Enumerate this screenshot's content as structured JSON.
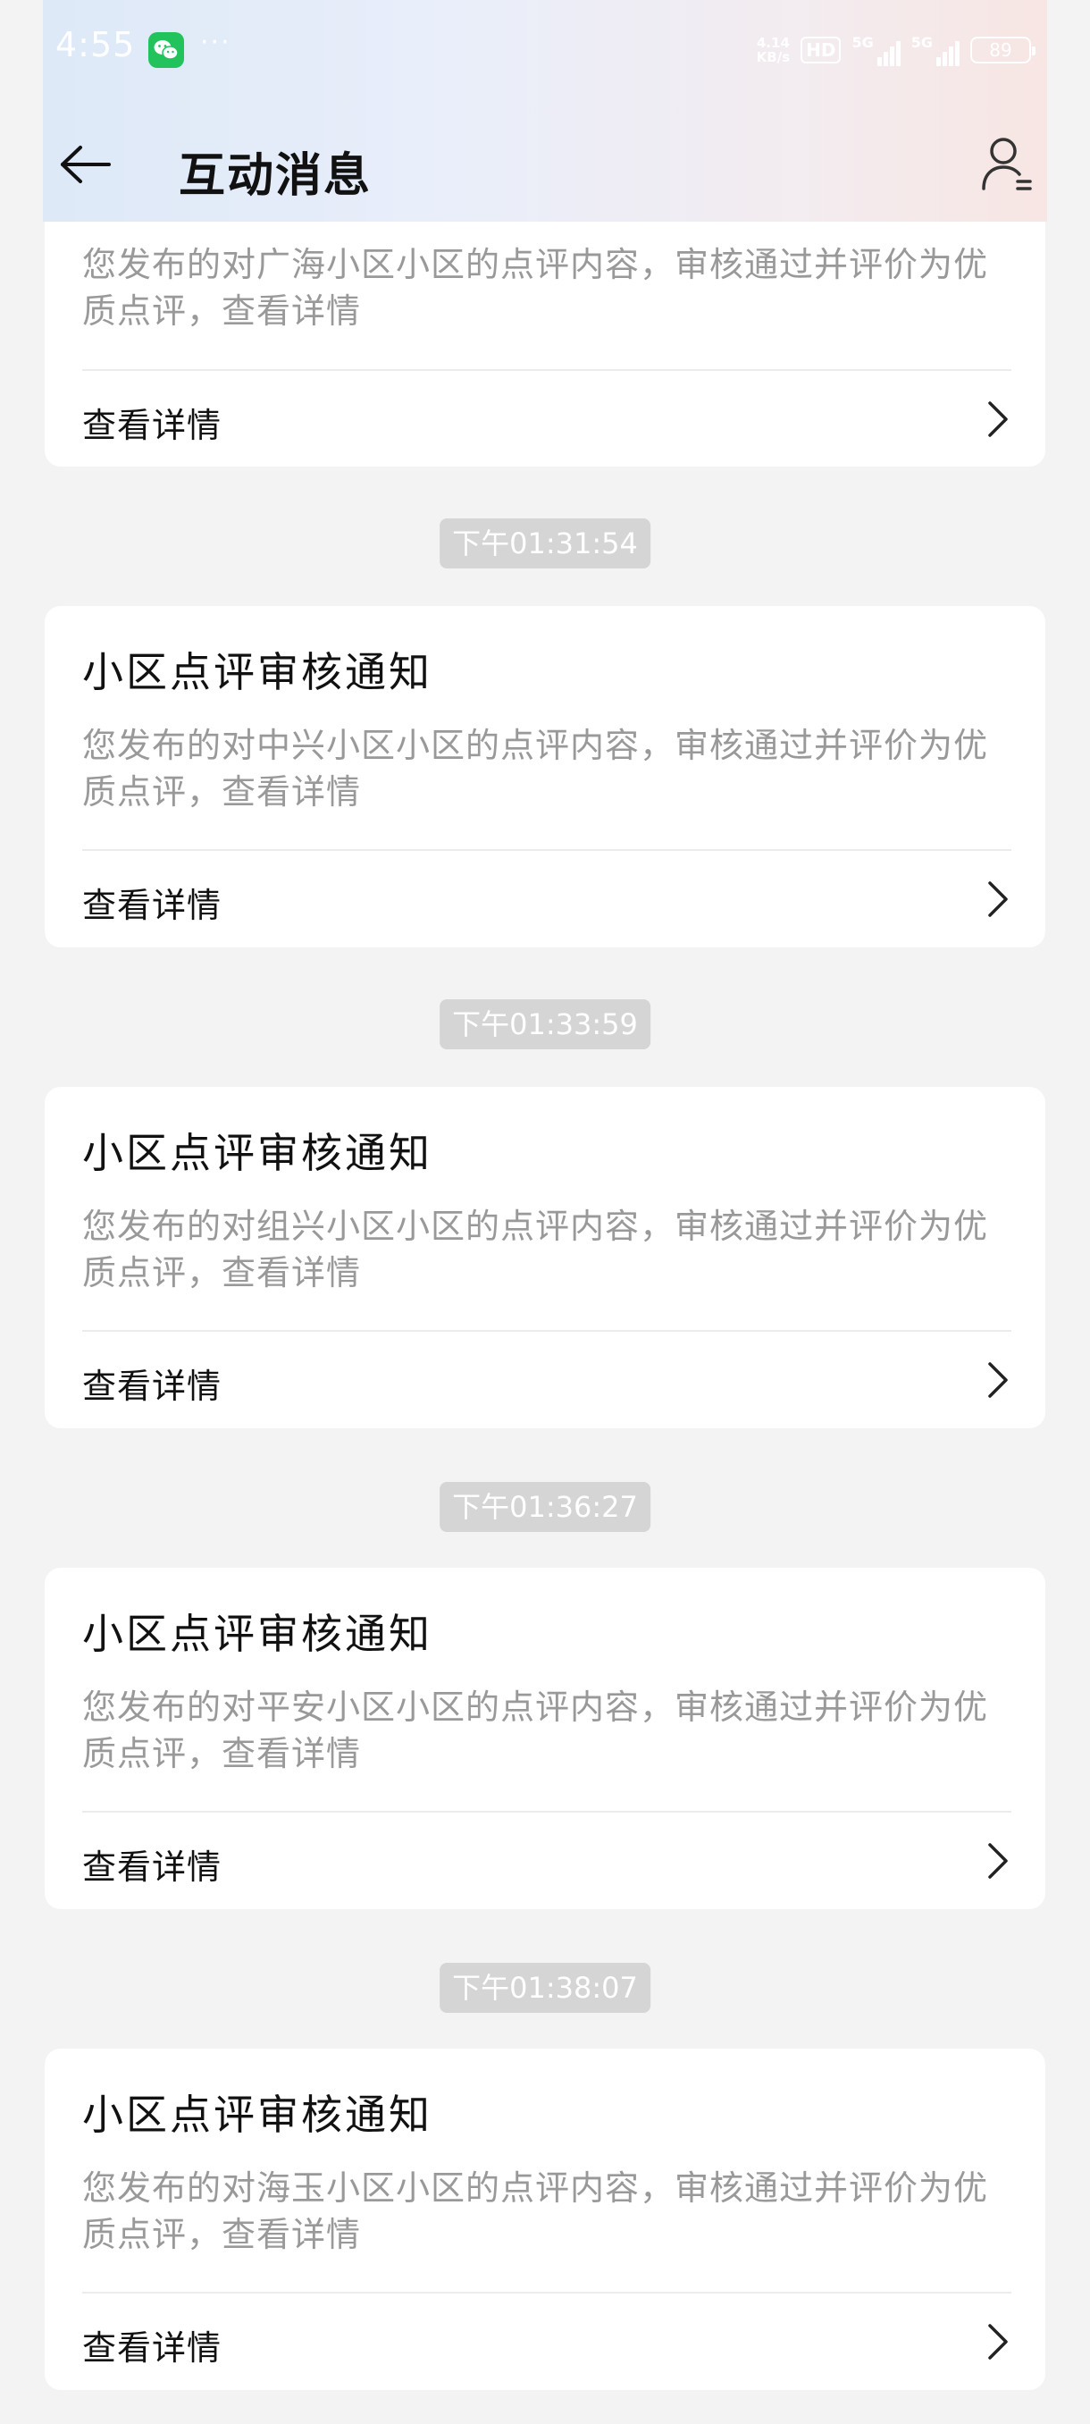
{
  "status_bar": {
    "time": "4:55",
    "more": "···",
    "net_speed_value": "4.14",
    "net_speed_unit": "KB/s",
    "hd": "HD",
    "signal1": "5G",
    "signal2": "5G",
    "battery": "89",
    "icons": [
      "wechat-icon",
      "signal-icon",
      "battery-icon"
    ]
  },
  "header": {
    "title": "互动消息",
    "back_icon": "arrow-left-icon",
    "profile_icon": "user-settings-icon"
  },
  "top_card": {
    "desc": "您发布的对广海小区小区的点评内容，审核通过并评价为优质点评，查看详情",
    "link": "查看详情"
  },
  "messages": [
    {
      "time": "下午01:31:54",
      "title": "小区点评审核通知",
      "desc": "您发布的对中兴小区小区的点评内容，审核通过并评价为优质点评，查看详情",
      "link": "查看详情"
    },
    {
      "time": "下午01:33:59",
      "title": "小区点评审核通知",
      "desc": "您发布的对组兴小区小区的点评内容，审核通过并评价为优质点评，查看详情",
      "link": "查看详情"
    },
    {
      "time": "下午01:36:27",
      "title": "小区点评审核通知",
      "desc": "您发布的对平安小区小区的点评内容，审核通过并评价为优质点评，查看详情",
      "link": "查看详情"
    },
    {
      "time": "下午01:38:07",
      "title": "小区点评审核通知",
      "desc": "您发布的对海玉小区小区的点评内容，审核通过并评价为优质点评，查看详情",
      "link": "查看详情"
    }
  ],
  "colors": {
    "background": "#f3f3f3",
    "card": "#ffffff",
    "desc_text": "#999999",
    "time_pill": "#d5d5d5",
    "wechat_green": "#22c35d"
  }
}
